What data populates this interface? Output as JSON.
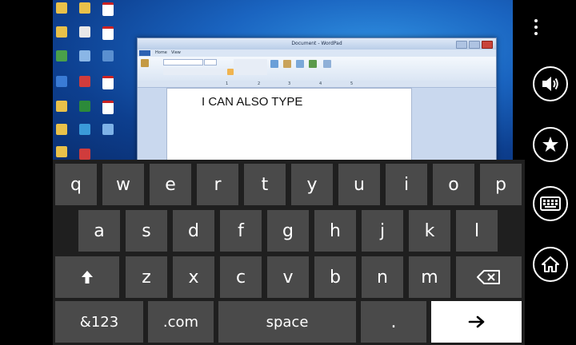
{
  "remote": {
    "window_title": "Document - WordPad",
    "tabs": [
      "",
      "Home",
      "View"
    ],
    "ruler_marks": [
      "1",
      "2",
      "3",
      "4",
      "5"
    ],
    "document_text": "I CAN ALSO TYPE"
  },
  "app_bar": {
    "buttons": [
      {
        "name": "more",
        "icon": "more-dots-icon"
      },
      {
        "name": "volume",
        "icon": "speaker-icon"
      },
      {
        "name": "favorites",
        "icon": "star-icon"
      },
      {
        "name": "keyboard",
        "icon": "keyboard-icon"
      },
      {
        "name": "home",
        "icon": "home-icon"
      }
    ]
  },
  "keyboard": {
    "row1": [
      "q",
      "w",
      "e",
      "r",
      "t",
      "y",
      "u",
      "i",
      "o",
      "p"
    ],
    "row2": [
      "a",
      "s",
      "d",
      "f",
      "g",
      "h",
      "j",
      "k",
      "l"
    ],
    "row3": [
      "z",
      "x",
      "c",
      "v",
      "b",
      "n",
      "m"
    ],
    "shift": "shift-arrow-icon",
    "backspace": "backspace-icon",
    "symbols": "&123",
    "dotcom": ".com",
    "space": "space",
    "period": ".",
    "enter": "enter-arrow-icon"
  },
  "colors": {
    "key_bg": "#4a4a4a",
    "keyboard_bg": "#1f1f1f",
    "enter_key_bg": "#ffffff",
    "desktop_blue": "#1a64c0"
  }
}
